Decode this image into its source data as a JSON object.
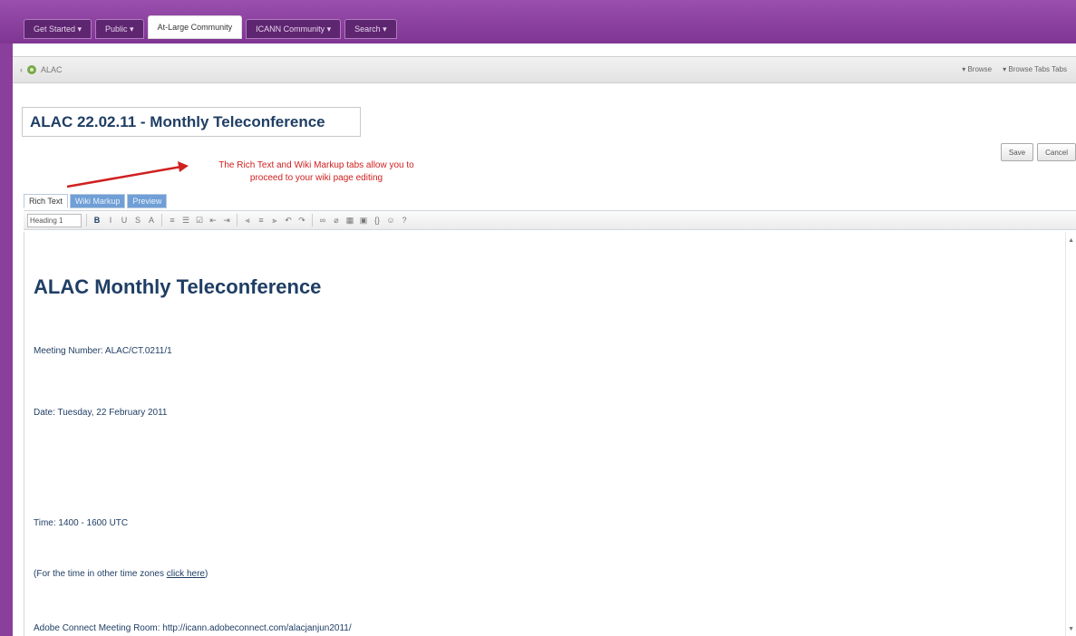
{
  "top_tabs": [
    {
      "label": "Get Started ▾"
    },
    {
      "label": "Public ▾"
    },
    {
      "label": "At-Large Community"
    },
    {
      "label": "ICANN Community ▾"
    },
    {
      "label": "Search ▾"
    }
  ],
  "breadcrumb": {
    "label": "ALAC"
  },
  "header_links": {
    "browse": "▾ Browse",
    "browse_tabs": "▾ Browse Tabs Tabs"
  },
  "page_title_value": "ALAC 22.02.11 - Monthly Teleconference",
  "actions": {
    "save": "Save",
    "cancel": "Cancel"
  },
  "annotation": {
    "line1": "The Rich Text and Wiki Markup tabs allow you to",
    "line2": "proceed to your wiki page editing"
  },
  "editor_tabs": {
    "rich": "Rich Text",
    "wiki": "Wiki Markup",
    "preview": "Preview"
  },
  "toolbar": {
    "format": "Heading 1"
  },
  "document": {
    "heading": "ALAC Monthly Teleconference",
    "meeting_number": "Meeting Number: ALAC/CT.0211/1",
    "date": "Date: Tuesday, 22 February 2011",
    "time": "Time: 1400 - 1600 UTC",
    "timezone_prefix": "(For the time in other time zones ",
    "timezone_link": "click here",
    "timezone_suffix": ")",
    "adobe": "Adobe Connect Meeting Room: http://icann.adobeconnect.com/alacjanjun2011/"
  },
  "colors": {
    "frame": "#8a3f9c",
    "heading": "#1f3e64",
    "annotation": "#d02020",
    "tab_blue": "#6f9fd6"
  }
}
